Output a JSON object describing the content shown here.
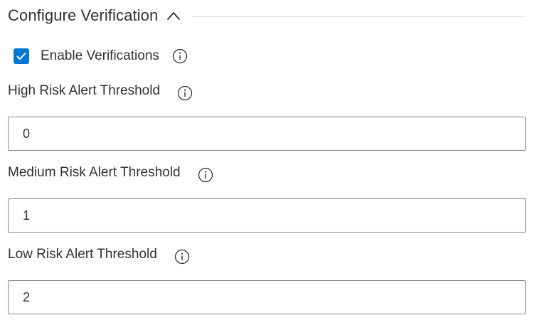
{
  "section": {
    "title": "Configure Verification",
    "toggle_icon": "chevron-up-icon",
    "expanded": true
  },
  "enable_verifications": {
    "label": "Enable Verifications",
    "checked": true,
    "info_icon": "info-icon"
  },
  "fields": [
    {
      "label": "High Risk Alert Threshold",
      "value": "0",
      "info_icon": "info-icon"
    },
    {
      "label": "Medium Risk Alert Threshold",
      "value": "1",
      "info_icon": "info-icon"
    },
    {
      "label": "Low Risk Alert Threshold",
      "value": "2",
      "info_icon": "info-icon"
    }
  ],
  "colors": {
    "accent": "#0078d4",
    "text": "#323130",
    "input_border": "#8a8886",
    "divider": "#e1dfdd"
  }
}
